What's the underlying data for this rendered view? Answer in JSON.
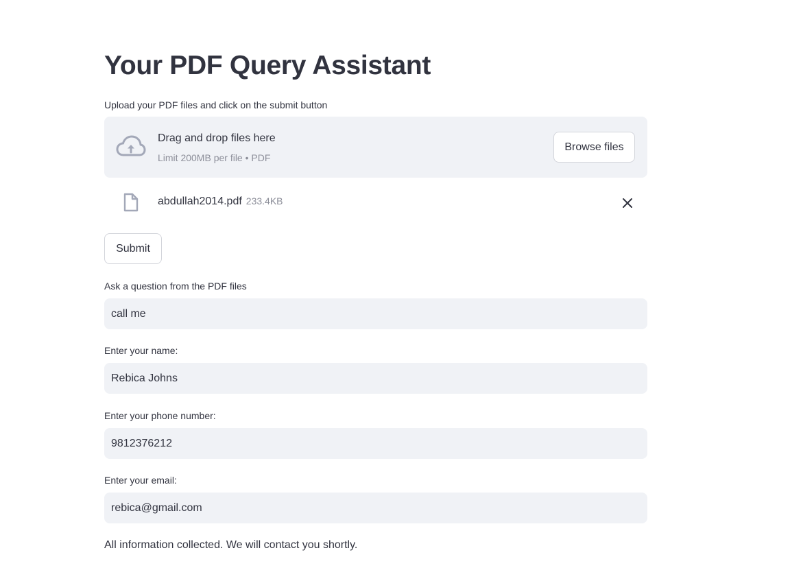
{
  "page": {
    "title": "Your PDF Query Assistant"
  },
  "uploader": {
    "label": "Upload your PDF files and click on the submit button",
    "drop_title": "Drag and drop files here",
    "drop_limit": "Limit 200MB per file • PDF",
    "browse_label": "Browse files",
    "file": {
      "name": "abdullah2014.pdf",
      "size": "233.4KB"
    }
  },
  "submit_label": "Submit",
  "question": {
    "label": "Ask a question from the PDF files",
    "value": "call me"
  },
  "name": {
    "label": "Enter your name:",
    "value": "Rebica Johns"
  },
  "phone": {
    "label": "Enter your phone number:",
    "value": "9812376212"
  },
  "email": {
    "label": "Enter your email:",
    "value": "rebica@gmail.com"
  },
  "status": "All information collected. We will contact you shortly.",
  "colors": {
    "text": "#31333f",
    "muted": "#8c8e99",
    "input_bg": "#f0f2f6",
    "icon": "#a3a8b8"
  }
}
